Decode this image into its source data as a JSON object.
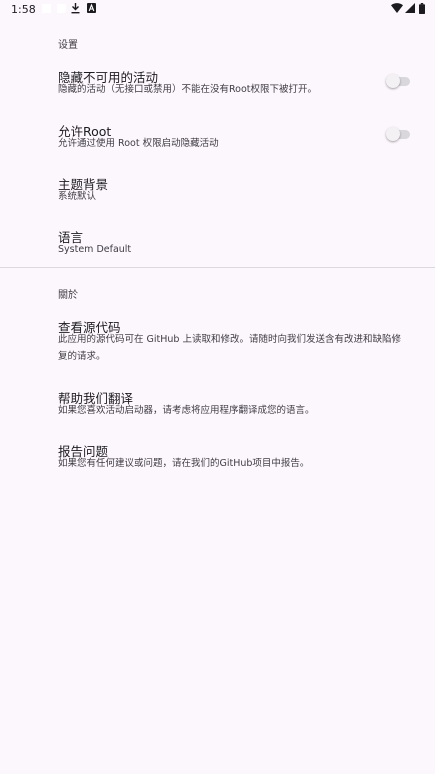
{
  "status_bar": {
    "time": "1:58"
  },
  "sections": {
    "settings": {
      "header": "设置",
      "hide_unavailable": {
        "title": "隐藏不可用的活动",
        "summary": "隐藏的活动（无接口或禁用）不能在没有Root权限下被打开。",
        "enabled": false
      },
      "allow_root": {
        "title": "允许Root",
        "summary": "允许通过使用 Root 权限启动隐藏活动",
        "enabled": false
      },
      "theme": {
        "title": "主题背景",
        "summary": "系统默认"
      },
      "language": {
        "title": "语言",
        "summary": "System Default"
      }
    },
    "about": {
      "header": "關於",
      "source_code": {
        "title": "查看源代码",
        "summary": "此应用的源代码可在 GitHub 上读取和修改。请随时向我们发送含有改进和缺陷修复的请求。"
      },
      "translate": {
        "title": "帮助我们翻译",
        "summary": "如果您喜欢活动启动器，请考虑将应用程序翻译成您的语言。"
      },
      "report": {
        "title": "报告问题",
        "summary": "如果您有任何建议或问题，请在我们的GitHub项目中报告。"
      }
    }
  },
  "colors": {
    "background": "#fcf7fd",
    "primary_text": "#1c1b1f",
    "secondary_text": "#3f3c44",
    "switch_track_off": "#d9d6dc",
    "switch_thumb_off": "#f3f1f4"
  }
}
